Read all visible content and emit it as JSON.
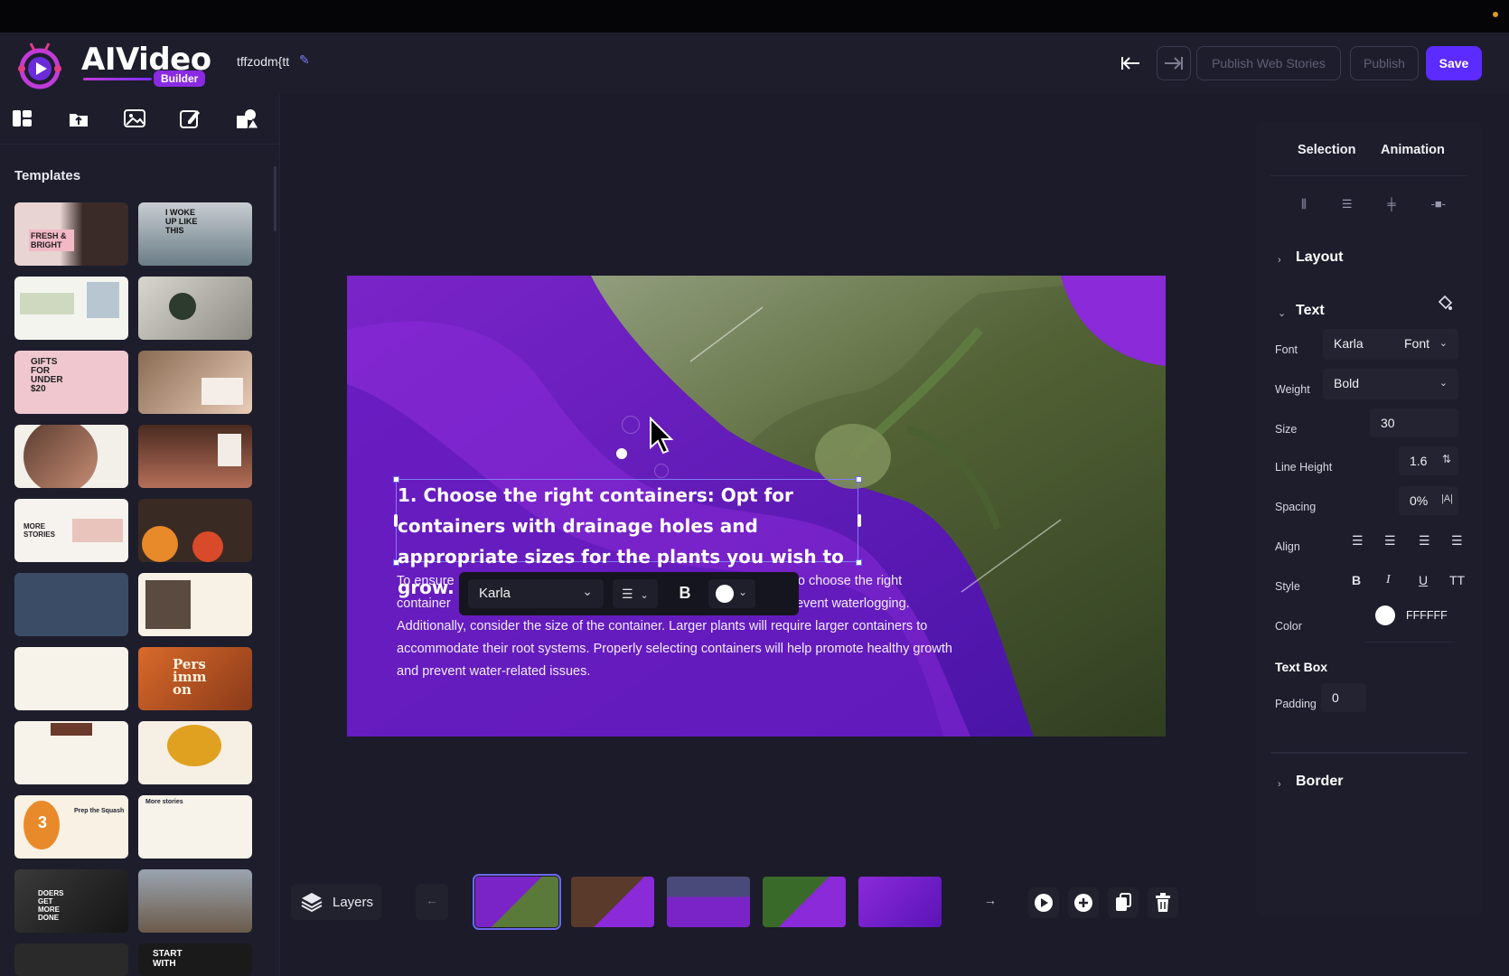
{
  "app": {
    "logo_text": "AIVideo",
    "logo_badge": "Builder",
    "project_name": "tffzodm{tt"
  },
  "header": {
    "undo_icon": "undo-icon",
    "redo_icon": "redo-icon",
    "publish_web_stories": "Publish Web Stories",
    "publish": "Publish",
    "save": "Save",
    "accent": "#5b2bff"
  },
  "sidebar": {
    "tool_icons": [
      "templates-icon",
      "upload-icon",
      "image-icon",
      "edit-icon",
      "shapes-icon"
    ],
    "section_title": "Templates",
    "thumb_texts": {
      "t1": "FRESH & BRIGHT",
      "t2": "I WOKE UP LIKE THIS",
      "t5": "GIFTS FOR UNDER $20",
      "t9": "MORE STORIES",
      "t14": "Pers imm on",
      "t17": "3",
      "t17b": "Prep the Squash",
      "t18": "More stories",
      "t19": "DOERS GET MORE DONE",
      "t22": "START WITH"
    }
  },
  "canvas": {
    "heading": "1. Choose the right containers: Opt for containers with drainage holes and appropriate sizes for the plants you wish to grow.",
    "body_line1_a": "To ensure",
    "body_line1_b": "tant to choose the right",
    "body_line2_a": "container",
    "body_line2_b": "s to prevent waterlogging.",
    "body_rest": "Additionally, consider the size of the container. Larger plants will require larger containers to accommodate their root systems. Properly selecting containers will help promote healthy growth and prevent water-related issues.",
    "toolbar": {
      "font": "Karla",
      "bold": "B"
    }
  },
  "bottom": {
    "layers_label": "Layers"
  },
  "right_panel": {
    "tabs": [
      "Selection",
      "Animation"
    ],
    "layout_title": "Layout",
    "text_title": "Text",
    "font_label": "Font",
    "font_value": "Karla",
    "font_dropdown": "Font",
    "weight_label": "Weight",
    "weight_value": "Bold",
    "size_label": "Size",
    "size_value": "30",
    "line_height_label": "Line Height",
    "line_height_value": "1.6",
    "spacing_label": "Spacing",
    "spacing_value": "0%",
    "align_label": "Align",
    "style_label": "Style",
    "color_label": "Color",
    "color_value": "FFFFFF",
    "textbox_title": "Text Box",
    "padding_label": "Padding",
    "padding_value": "0",
    "border_title": "Border"
  }
}
